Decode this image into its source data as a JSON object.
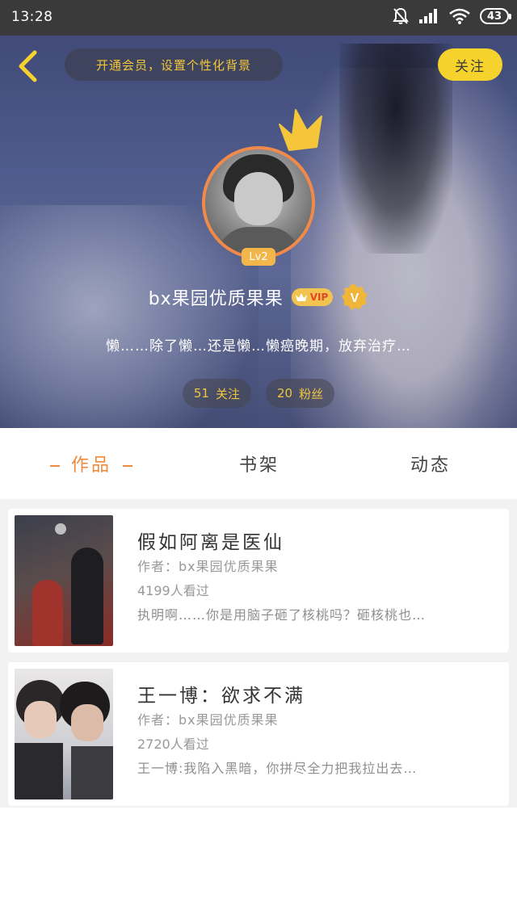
{
  "status_bar": {
    "time": "13:28",
    "battery": "43"
  },
  "header": {
    "vip_prompt": "开通会员，设置个性化背景",
    "follow_label": "关注"
  },
  "profile": {
    "level": "Lv2",
    "username": "bx果园优质果果",
    "vip_badge": "VIP",
    "verified_badge": "V",
    "bio": "懒……除了懒…还是懒…懒癌晚期，放弃治疗…",
    "following_count": "51",
    "following_label": "关注",
    "followers_count": "20",
    "followers_label": "粉丝"
  },
  "tabs": [
    {
      "label": "作品",
      "active": true
    },
    {
      "label": "书架",
      "active": false
    },
    {
      "label": "动态",
      "active": false
    }
  ],
  "books": [
    {
      "title": "假如阿离是医仙",
      "author": "作者：bx果园优质果果",
      "views": "4199人看过",
      "intro": "执明啊……你是用脑子砸了核桃吗？砸核桃也…"
    },
    {
      "title": "王一博：欲求不满",
      "author": "作者：bx果园优质果果",
      "views": "2720人看过",
      "intro": "王一博:我陷入黑暗，你拼尽全力把我拉出去…"
    }
  ],
  "colors": {
    "accent": "#f08a3c",
    "follow_button": "#f6d32c",
    "gold_text": "#f2c63b",
    "avatar_border": "#f08a4b"
  }
}
